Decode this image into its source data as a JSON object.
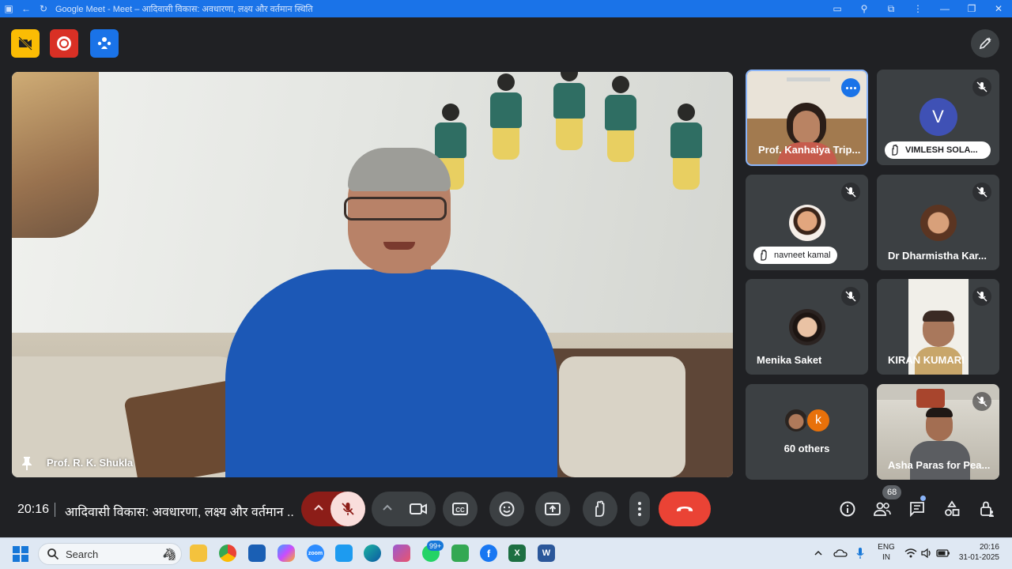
{
  "window": {
    "title": "Google Meet - Meet – आदिवासी विकास: अवधारणा, लक्ष्य और वर्तमान स्थिति"
  },
  "main_stage": {
    "speaker_name": "Prof. R. K. Shukla"
  },
  "participants": [
    {
      "name": "Prof. Kanhaiya Trip...",
      "type": "video",
      "active": true,
      "options": true
    },
    {
      "name": "VIMLESH SOLA...",
      "type": "initial",
      "initial": "V",
      "avatar_color": "#3f51b5",
      "hand_raised": true,
      "muted": true
    },
    {
      "name": "navneet kamal",
      "type": "photo",
      "hand_raised": true,
      "muted": true
    },
    {
      "name": "Dr Dharmistha Kar...",
      "type": "photo",
      "muted": true
    },
    {
      "name": "Menika Saket",
      "type": "photo",
      "muted": true
    },
    {
      "name": "KIRAN KUMARI",
      "type": "video",
      "muted": true
    },
    {
      "name": "60 others",
      "type": "others",
      "initial": "k",
      "avatar_color": "#e8710a"
    },
    {
      "name": "Asha Paras for Pea...",
      "type": "video",
      "muted": true
    }
  ],
  "bottom_bar": {
    "time": "20:16",
    "meeting_title": "आदिवासी विकास: अवधारणा, लक्ष्य और वर्तमान ...",
    "people_count": "68"
  },
  "taskbar": {
    "search_label": "Search",
    "whatsapp_badge": "99+",
    "language_line1": "ENG",
    "language_line2": "IN",
    "time": "20:16",
    "date": "31-01-2025",
    "apps": [
      "file-explorer",
      "chrome",
      "store",
      "copilot",
      "zoom",
      "twitter",
      "edge",
      "video-editor",
      "whatsapp",
      "facetime",
      "facebook",
      "excel",
      "word"
    ]
  },
  "colors": {
    "meet_bg": "#202124",
    "tile_bg": "#3c4043",
    "accent": "#1a73e8",
    "end_call": "#ea4335"
  }
}
